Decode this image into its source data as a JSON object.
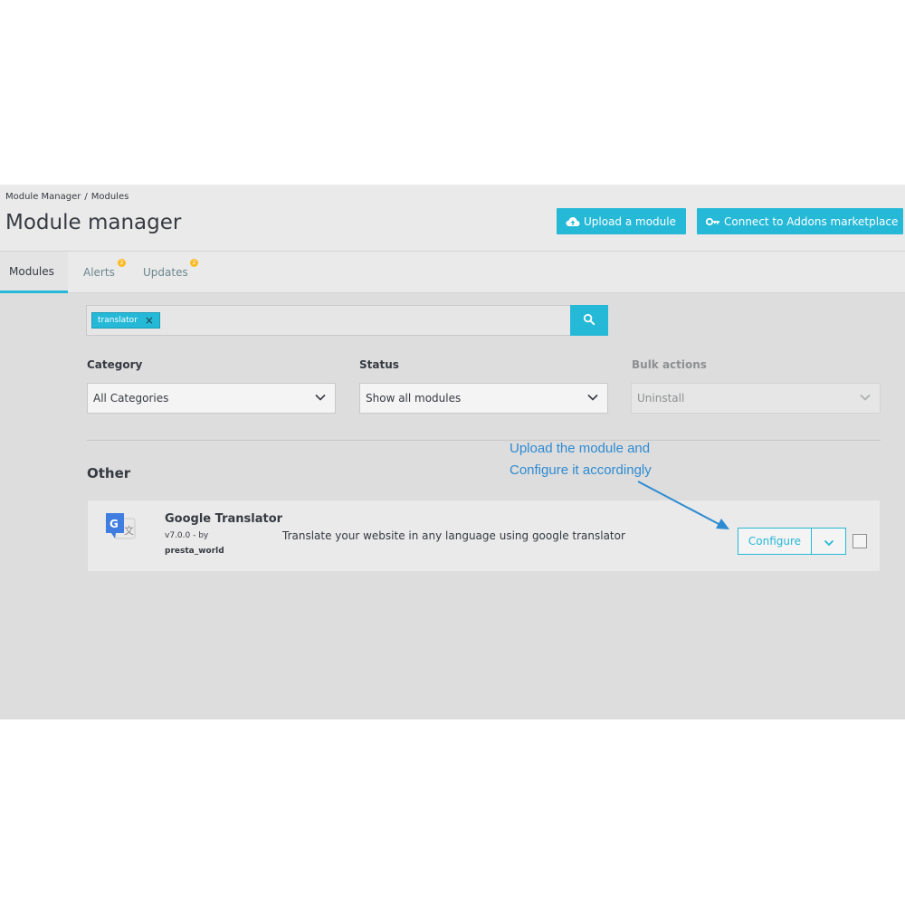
{
  "breadcrumb": {
    "items": [
      "Module Manager",
      "Modules"
    ],
    "separator": "/"
  },
  "header": {
    "title": "Module manager",
    "upload_label": "Upload a module",
    "connect_label": "Connect to Addons marketplace"
  },
  "tabs": [
    {
      "label": "Modules",
      "active": true
    },
    {
      "label": "Alerts",
      "badge": "2"
    },
    {
      "label": "Updates",
      "badge": "2"
    }
  ],
  "search": {
    "tag": "translator",
    "tag_remove": "×"
  },
  "filters": {
    "category": {
      "label": "Category",
      "value": "All Categories"
    },
    "status": {
      "label": "Status",
      "value": "Show all modules"
    },
    "bulk": {
      "label": "Bulk actions",
      "value": "Uninstall"
    }
  },
  "section": {
    "title": "Other"
  },
  "annotation": {
    "line1": "Upload the module and",
    "line2": "Configure it accordingly",
    "color": "#2e8bd1"
  },
  "module": {
    "name": "Google Translator",
    "version": "v7.0.0 - by",
    "author": "presta_world",
    "description": "Translate your website in any language using google translator",
    "configure_label": "Configure",
    "icon": "google-translate-icon"
  },
  "colors": {
    "accent": "#25b9d7",
    "badge": "#fbbb22"
  }
}
